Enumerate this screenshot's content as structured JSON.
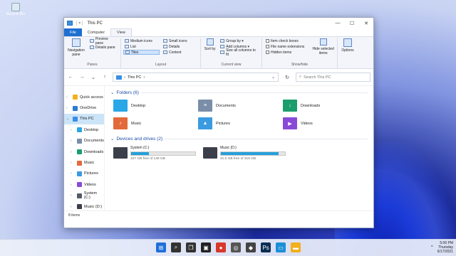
{
  "desktop": {
    "recycle_label": "Recycle Bin"
  },
  "window": {
    "title": "This PC",
    "controls": {
      "minimize": "—",
      "maximize": "☐",
      "close": "✕"
    },
    "tabs": [
      "File",
      "Computer",
      "View"
    ],
    "ribbon": {
      "panes": {
        "label": "Panes",
        "nav_pane": "Navigation pane",
        "preview": "Preview pane",
        "details": "Details pane"
      },
      "layout": {
        "label": "Layout",
        "items": [
          "Medium icons",
          "Small icons",
          "List",
          "Details",
          "Tiles",
          "Content"
        ]
      },
      "current_view": {
        "label": "Current view",
        "sort_by": "Sort by",
        "group_by": "Group by ▾",
        "add_columns": "Add columns ▾",
        "size_all": "Size all columns to fit"
      },
      "show_hide": {
        "label": "Show/hide",
        "item_check": "Item check boxes",
        "file_ext": "File name extensions",
        "hidden_items": "Hidden items",
        "hide_selected": "Hide selected items"
      },
      "options": "Options"
    },
    "nav": {
      "back": "←",
      "forward": "→",
      "up_dropdown": "⌄",
      "up": "↑",
      "address": "This PC",
      "address_sep": "›",
      "address_dd": "⌄",
      "refresh": "↻",
      "search_placeholder": "Search This PC"
    },
    "sidebar": [
      {
        "label": "Quick access",
        "color": "#f2b01e",
        "caret": "›"
      },
      {
        "label": "OneDrive",
        "color": "#2b7cd3",
        "caret": "›"
      },
      {
        "label": "This PC",
        "color": "#3a8ee6",
        "caret": "⌄",
        "selected": true
      },
      {
        "label": "Desktop",
        "color": "#2aa7e6",
        "caret": "›",
        "sub": true
      },
      {
        "label": "Documents",
        "color": "#7a8ea8",
        "caret": "›",
        "sub": true
      },
      {
        "label": "Downloads",
        "color": "#1a9e6e",
        "caret": "›",
        "sub": true
      },
      {
        "label": "Music",
        "color": "#e26a3a",
        "caret": "›",
        "sub": true
      },
      {
        "label": "Pictures",
        "color": "#3a9be0",
        "caret": "›",
        "sub": true
      },
      {
        "label": "Videos",
        "color": "#8a4ad8",
        "caret": "›",
        "sub": true
      },
      {
        "label": "System (C:)",
        "color": "#555b66",
        "caret": "›",
        "sub": true
      },
      {
        "label": "Music (D:)",
        "color": "#3a3f4a",
        "caret": "›",
        "sub": true
      }
    ],
    "folders_header": "Folders (6)",
    "folders": [
      {
        "label": "Desktop",
        "color": "#2aa7e6",
        "glyph": ""
      },
      {
        "label": "Documents",
        "color": "#7a8ea8",
        "glyph": "≡"
      },
      {
        "label": "Downloads",
        "color": "#1a9e6e",
        "glyph": "↓"
      },
      {
        "label": "Music",
        "color": "#e26a3a",
        "glyph": "♪"
      },
      {
        "label": "Pictures",
        "color": "#3a9be0",
        "glyph": "▲"
      },
      {
        "label": "Videos",
        "color": "#8a4ad8",
        "glyph": "▶"
      }
    ],
    "drives_header": "Devices and drives (2)",
    "drives": [
      {
        "label": "System (C:)",
        "free": "107 GB free of 149 GB",
        "used_fraction": 0.28
      },
      {
        "label": "Music (D:)",
        "free": "31.0 GB free of 315 GB",
        "used_fraction": 0.9
      }
    ],
    "status": "8 items"
  },
  "taskbar": {
    "icons": [
      {
        "name": "start-icon",
        "color": "#1e6fd9",
        "glyph": "⊞"
      },
      {
        "name": "search-icon",
        "color": "#333333",
        "glyph": "⌕"
      },
      {
        "name": "task-view-icon",
        "color": "#333333",
        "glyph": "❐"
      },
      {
        "name": "app-icon-1",
        "color": "#222222",
        "glyph": "▣"
      },
      {
        "name": "app-icon-2",
        "color": "#d9372b",
        "glyph": "●"
      },
      {
        "name": "app-icon-3",
        "color": "#555555",
        "glyph": "◎"
      },
      {
        "name": "app-icon-4",
        "color": "#444444",
        "glyph": "◆"
      },
      {
        "name": "photoshop-icon",
        "color": "#0b2d52",
        "glyph": "Ps"
      },
      {
        "name": "monitor-icon",
        "color": "#1b8fd6",
        "glyph": "▭"
      },
      {
        "name": "file-explorer-icon",
        "color": "#f2b01e",
        "glyph": "▬"
      }
    ],
    "tray_up": "^",
    "time": "5:06 PM",
    "day": "Thursday",
    "date": "6/17/2021"
  }
}
